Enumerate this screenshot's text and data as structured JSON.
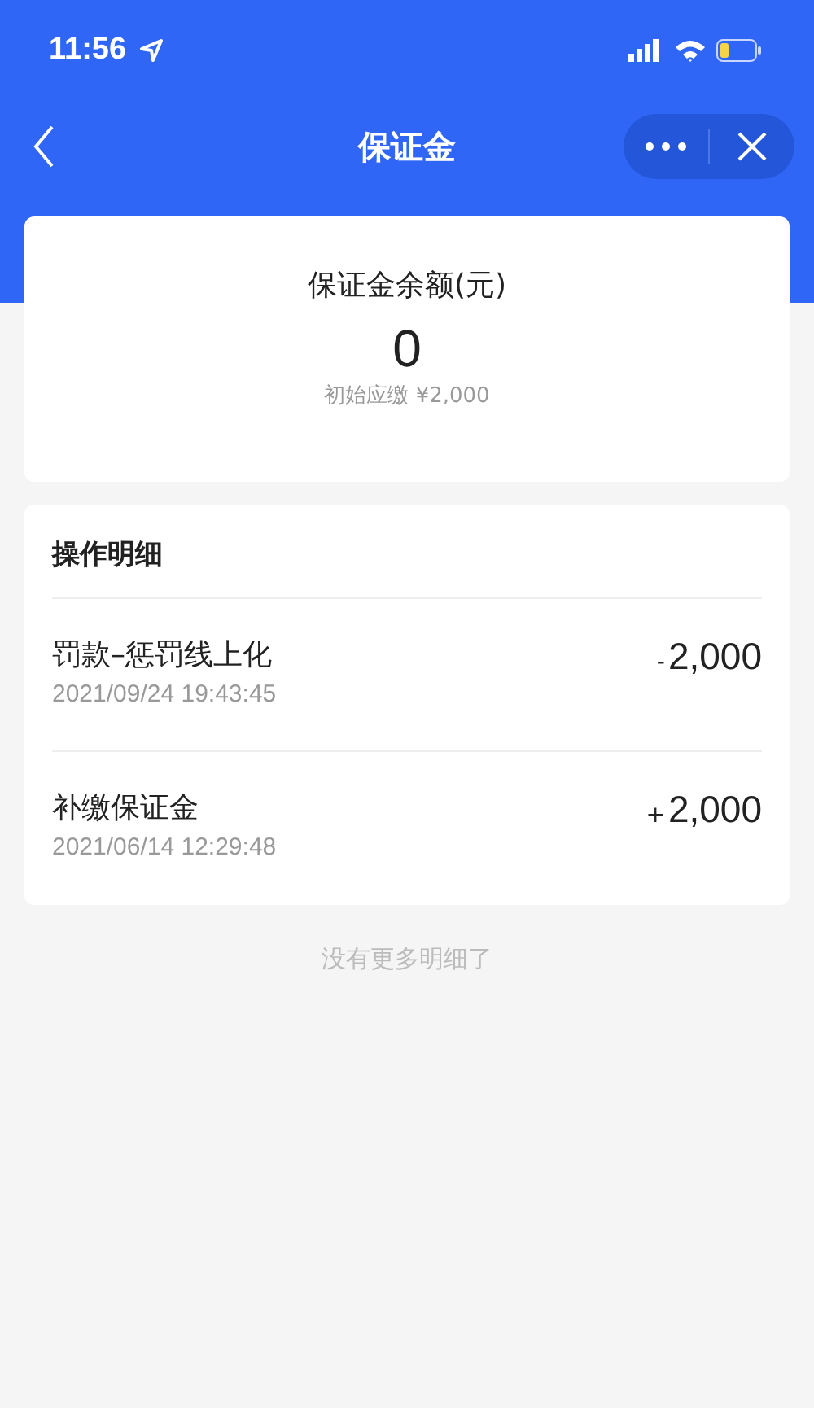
{
  "status_bar": {
    "time": "11:56"
  },
  "nav": {
    "title": "保证金"
  },
  "balance": {
    "label": "保证金余额(元)",
    "amount": "0",
    "note": "初始应缴 ¥2,000"
  },
  "details": {
    "title": "操作明细",
    "items": [
      {
        "name": "罚款–惩罚线上化",
        "time": "2021/09/24 19:43:45",
        "sign": "-",
        "amount": "2,000"
      },
      {
        "name": "补缴保证金",
        "time": "2021/06/14 12:29:48",
        "sign": "+",
        "amount": "2,000"
      }
    ]
  },
  "footer": "没有更多明细了"
}
